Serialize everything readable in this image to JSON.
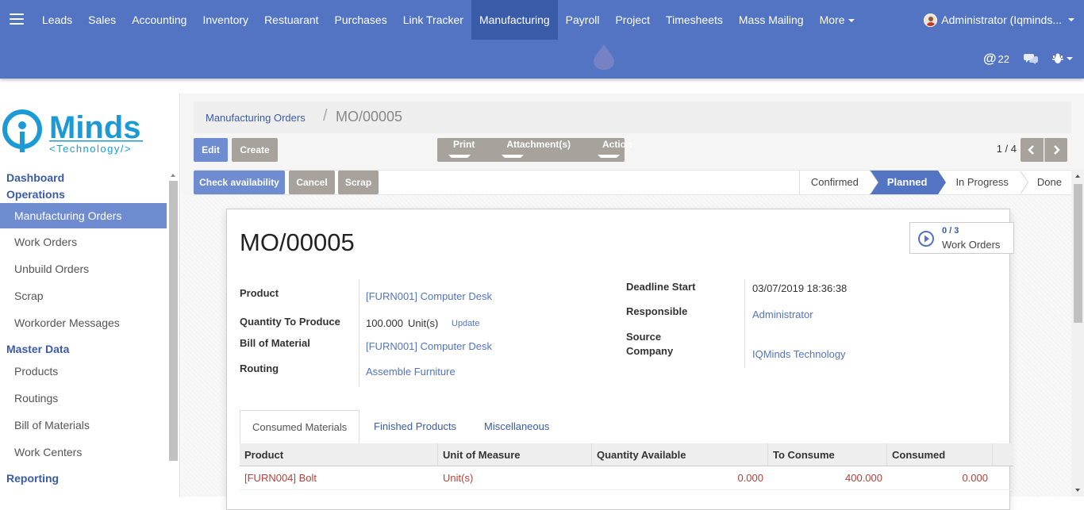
{
  "navbar": {
    "menu_icon": "hamburger-icon",
    "items": [
      "Leads",
      "Sales",
      "Accounting",
      "Inventory",
      "Restuarant",
      "Purchases",
      "Link Tracker",
      "Manufacturing",
      "Payroll",
      "Project",
      "Timesheets",
      "Mass Mailing",
      "More"
    ],
    "active": "Manufacturing",
    "user": "Administrator (Iqminds...",
    "mentions_count": "22",
    "colors": {
      "bar": "#5274c2",
      "active": "#3a5ba7"
    }
  },
  "sidebar": {
    "logo_brand": "Minds",
    "logo_tagline": "<Technology/>",
    "sections": [
      {
        "label": "Dashboard",
        "items": []
      },
      {
        "label": "Operations",
        "items": [
          "Manufacturing Orders",
          "Work Orders",
          "Unbuild Orders",
          "Scrap",
          "Workorder Messages"
        ]
      },
      {
        "label": "Master Data",
        "items": [
          "Products",
          "Routings",
          "Bill of Materials",
          "Work Centers"
        ]
      },
      {
        "label": "Reporting",
        "items": []
      }
    ],
    "active_item": "Manufacturing Orders"
  },
  "breadcrumb": {
    "parent": "Manufacturing Orders",
    "separator": "/",
    "current": "MO/00005"
  },
  "toolbar": {
    "edit": "Edit",
    "create": "Create",
    "print": "Print",
    "attachments": "Attachment(s)",
    "action": "Action",
    "pager": "1 / 4"
  },
  "status_buttons": {
    "check_availability": "Check availability",
    "cancel": "Cancel",
    "scrap": "Scrap"
  },
  "stages": [
    "Confirmed",
    "Planned",
    "In Progress",
    "Done"
  ],
  "current_stage": "Planned",
  "record": {
    "title": "MO/00005",
    "work_orders_count": "0 / 3",
    "work_orders_label": "Work Orders",
    "product_label": "Product",
    "product": "[FURN001] Computer Desk",
    "qty_label": "Quantity To Produce",
    "qty": "100.000",
    "uom": "Unit(s)",
    "update": "Update",
    "bom_label": "Bill of Material",
    "bom": "[FURN001] Computer Desk",
    "routing_label": "Routing",
    "routing": "Assemble Furniture",
    "deadline_label": "Deadline Start",
    "deadline": "03/07/2019 18:36:38",
    "responsible_label": "Responsible",
    "responsible": "Administrator",
    "source_label": "Source",
    "company_label": "Company",
    "company": "IQMinds Technology"
  },
  "tabs": [
    "Consumed Materials",
    "Finished Products",
    "Miscellaneous"
  ],
  "active_tab": "Consumed Materials",
  "table": {
    "columns": [
      "Product",
      "Unit of Measure",
      "Quantity Available",
      "To Consume",
      "Consumed"
    ],
    "rows": [
      [
        "[FURN004] Bolt",
        "Unit(s)",
        "0.000",
        "400.000",
        "0.000"
      ]
    ]
  }
}
